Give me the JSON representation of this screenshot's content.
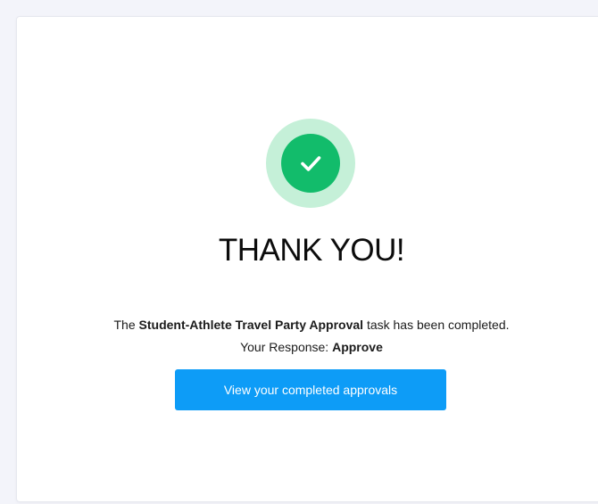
{
  "success": {
    "icon": "check-icon",
    "colors": {
      "outer_circle": "#c5f0d8",
      "inner_circle": "#12bc6b",
      "check": "#ffffff"
    }
  },
  "title": "THANK YOU!",
  "message": {
    "prefix": "The ",
    "task_name": "Student-Athlete Travel Party Approval",
    "suffix": " task has been completed.",
    "response_label": "Your Response: ",
    "response_value": "Approve"
  },
  "button": {
    "label": "View your completed approvals",
    "color": "#0d9cf7"
  }
}
